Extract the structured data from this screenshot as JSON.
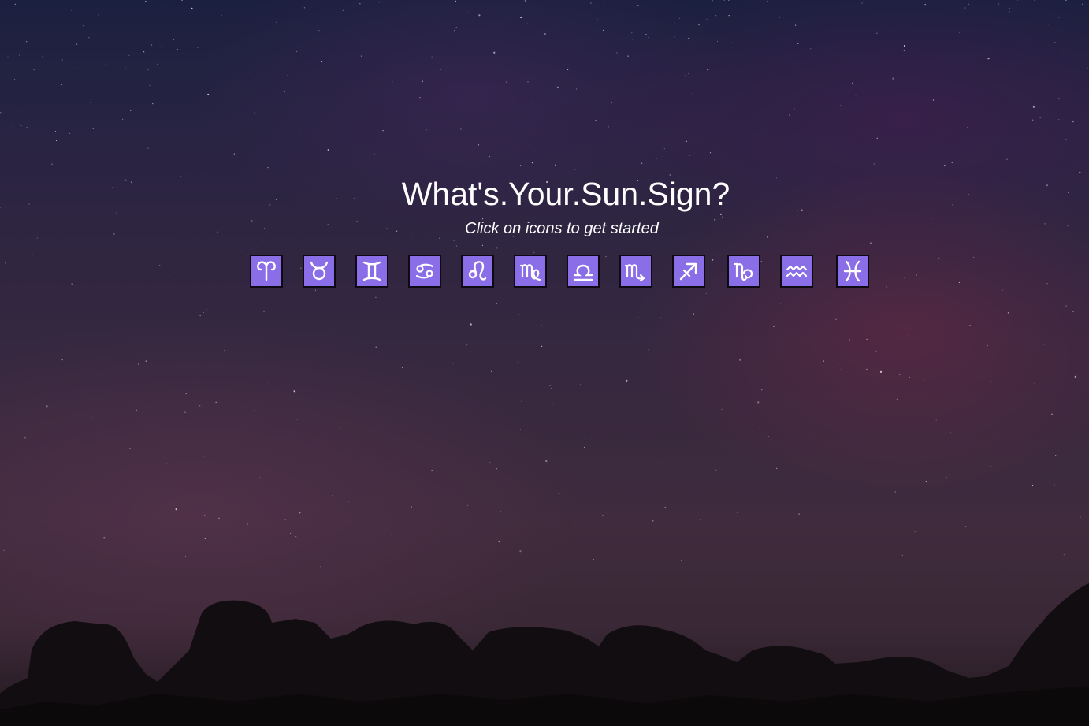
{
  "page": {
    "title": "What's.Your.Sun.Sign?",
    "subtitle": "Click on icons to get started"
  },
  "signs": [
    {
      "name": "aries",
      "icon": "aries-icon"
    },
    {
      "name": "taurus",
      "icon": "taurus-icon"
    },
    {
      "name": "gemini",
      "icon": "gemini-icon"
    },
    {
      "name": "cancer",
      "icon": "cancer-icon"
    },
    {
      "name": "leo",
      "icon": "leo-icon"
    },
    {
      "name": "virgo",
      "icon": "virgo-icon"
    },
    {
      "name": "libra",
      "icon": "libra-icon"
    },
    {
      "name": "scorpio",
      "icon": "scorpio-icon"
    },
    {
      "name": "sagittarius",
      "icon": "sagittarius-icon"
    },
    {
      "name": "capricorn",
      "icon": "capricorn-icon"
    },
    {
      "name": "aquarius",
      "icon": "aquarius-icon"
    },
    {
      "name": "pisces",
      "icon": "pisces-icon"
    }
  ],
  "colors": {
    "icon_background": "#8a6ee8",
    "icon_border": "#0d0a14",
    "text": "#ffffff"
  }
}
